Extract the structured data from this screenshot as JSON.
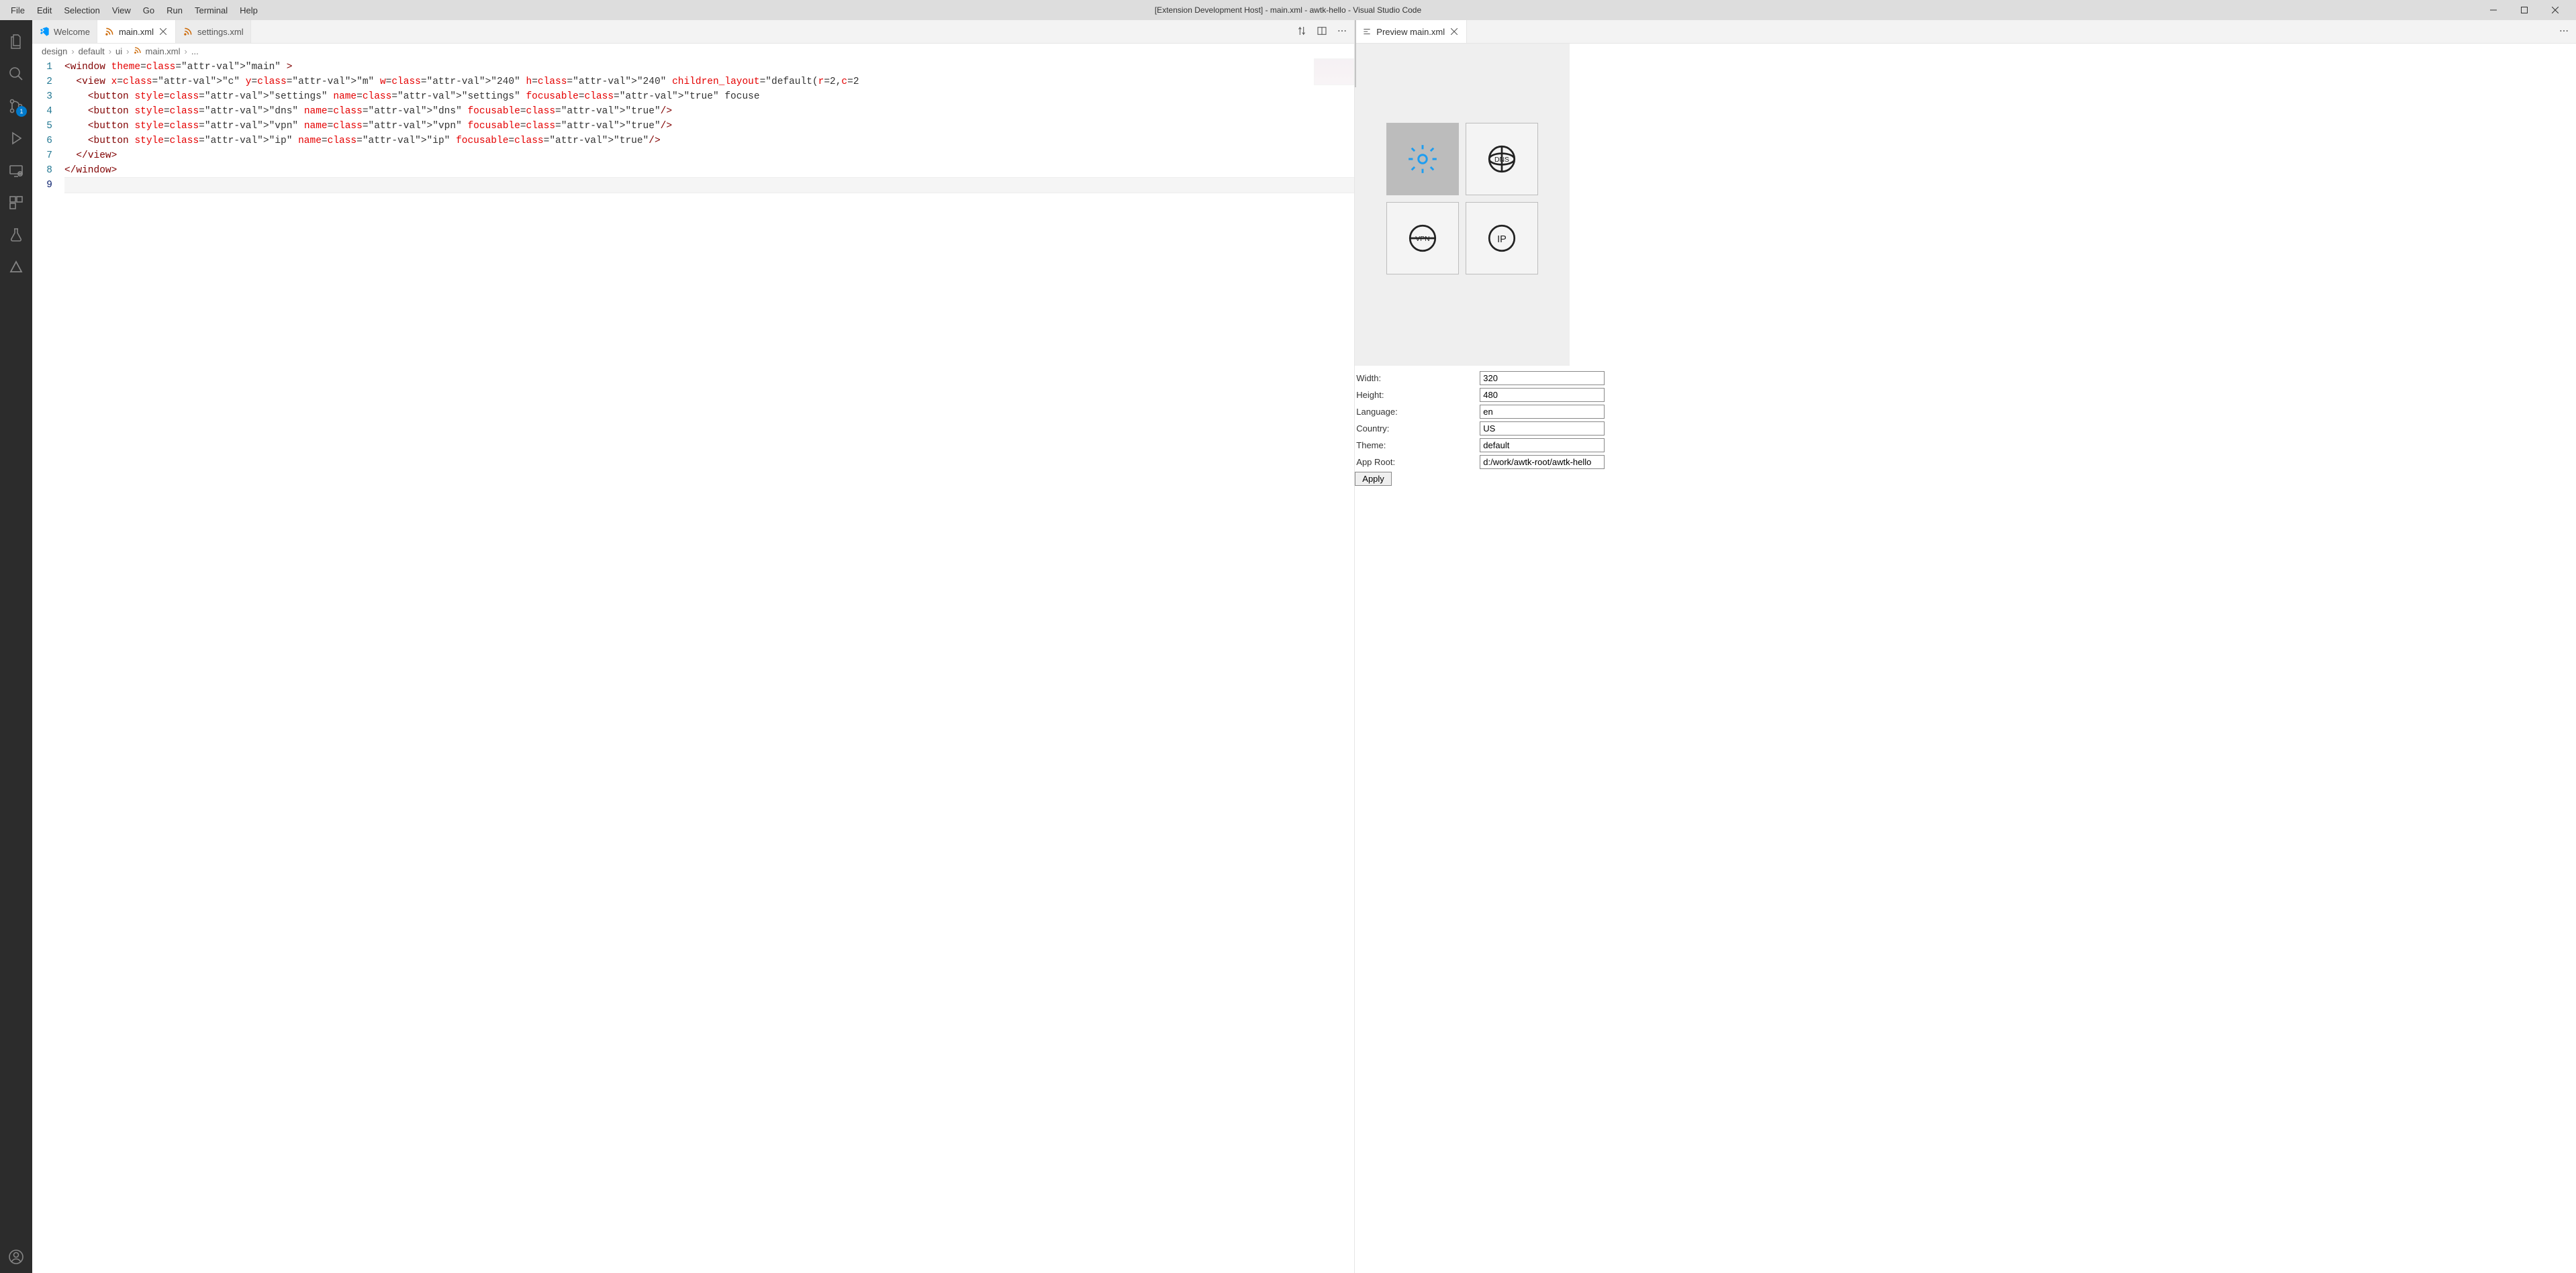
{
  "title": "[Extension Development Host] - main.xml - awtk-hello - Visual Studio Code",
  "menu": [
    "File",
    "Edit",
    "Selection",
    "View",
    "Go",
    "Run",
    "Terminal",
    "Help"
  ],
  "activity_badge_scm": "1",
  "tabs_left": [
    {
      "label": "Welcome",
      "icon": "vscode",
      "active": false,
      "closable": false
    },
    {
      "label": "main.xml",
      "icon": "rss",
      "active": true,
      "closable": true
    },
    {
      "label": "settings.xml",
      "icon": "rss",
      "active": false,
      "closable": false
    }
  ],
  "tabs_right": [
    {
      "label": "Preview main.xml",
      "icon": "preview",
      "active": true,
      "closable": true
    }
  ],
  "breadcrumb": [
    "design",
    "default",
    "ui",
    "main.xml",
    "..."
  ],
  "code": {
    "lines": [
      "<window theme=\"main\" >",
      "  <view x=\"c\" y=\"m\" w=\"240\" h=\"240\" children_layout=\"default(r=2,c=2",
      "    <button style=\"settings\" name=\"settings\" focusable=\"true\" focuse",
      "    <button style=\"dns\" name=\"dns\" focusable=\"true\"/>",
      "    <button style=\"vpn\" name=\"vpn\" focusable=\"true\"/>",
      "    <button style=\"ip\" name=\"ip\" focusable=\"true\"/>",
      "  </view>",
      "</window>",
      ""
    ],
    "current_line": 9
  },
  "preview": {
    "buttons": [
      {
        "name": "settings",
        "focused": true
      },
      {
        "name": "dns",
        "focused": false
      },
      {
        "name": "vpn",
        "focused": false
      },
      {
        "name": "ip",
        "focused": false
      }
    ]
  },
  "form": {
    "width_label": "Width:",
    "width_value": "320",
    "height_label": "Height:",
    "height_value": "480",
    "language_label": "Language:",
    "language_value": "en",
    "country_label": "Country:",
    "country_value": "US",
    "theme_label": "Theme:",
    "theme_value": "default",
    "app_root_label": "App Root:",
    "app_root_value": "d:/work/awtk-root/awtk-hello",
    "apply_label": "Apply"
  }
}
